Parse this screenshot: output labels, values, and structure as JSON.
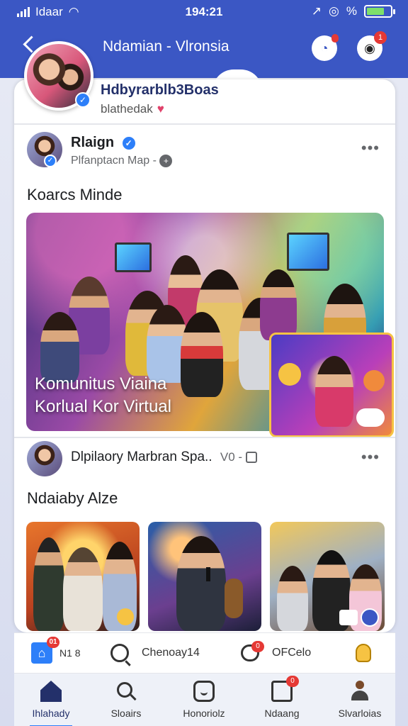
{
  "status_bar": {
    "carrier": "Idaar",
    "time": "194:21",
    "battery_pct": "%",
    "battery_level": 0.75
  },
  "header": {
    "title": "Ndamian - Vlronsia",
    "messenger_badge": "",
    "notif_badge": "1"
  },
  "profile": {
    "name": "Hdbyrarblb3Boas",
    "subtitle": "blathedak"
  },
  "post1": {
    "author": "Rlaign",
    "meta": "Plfanptacn Map -",
    "more": "•••",
    "text": "Koarcs Minde",
    "image_caption_line1": "Komunitus Viaina",
    "image_caption_line2": "Korlual Kor Virtual"
  },
  "post2": {
    "author": "Dlpilaory Marbran Spa..",
    "meta": "V0 -",
    "more": "•••",
    "text": "Ndaiaby Alze"
  },
  "actions": [
    {
      "label": "N1 8",
      "badge": "01",
      "icon": "home-square-icon"
    },
    {
      "label": "Chenoay14",
      "icon": "search-icon"
    },
    {
      "label": "OFCelo",
      "badge": "0",
      "icon": "chat-bubble-icon"
    },
    {
      "label": "",
      "icon": "light-bulb-icon"
    }
  ],
  "tabs": [
    {
      "label": "Ihlahady",
      "icon": "home-icon",
      "active": true
    },
    {
      "label": "Sloairs",
      "icon": "search-icon"
    },
    {
      "label": "Honoriolz",
      "icon": "smile-icon"
    },
    {
      "label": "Ndaang",
      "icon": "edit-icon",
      "badge": "0"
    },
    {
      "label": "Slvarloias",
      "icon": "profile-icon"
    }
  ],
  "colors": {
    "brand": "#3b57c4",
    "accent": "#2d7ff9",
    "badge": "#e53935"
  }
}
